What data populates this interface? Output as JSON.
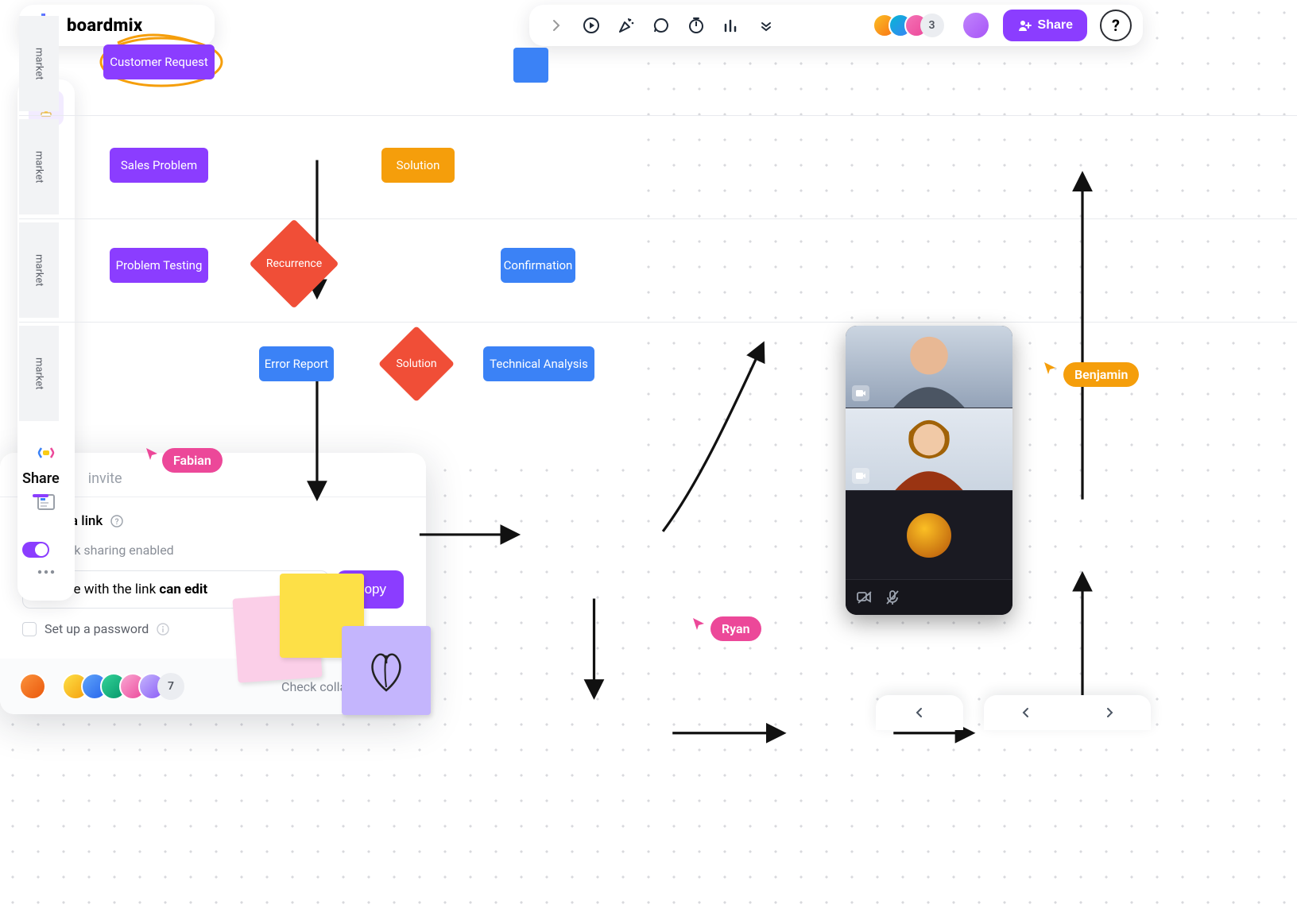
{
  "app": {
    "name": "boardmix"
  },
  "toolbar": {
    "presence_overflow": "3",
    "share_label": "Share",
    "help_label": "?"
  },
  "share_panel": {
    "tab_share": "Share",
    "tab_invite": "invite",
    "section_title": "Share via link",
    "toggle_label": "Link sharing enabled",
    "select_prefix": "Anyone with the link",
    "select_permission": "can edit",
    "copy_label": "Copy",
    "password_label": "Set up a password",
    "collab_overflow": "7",
    "check_collab": "Check collaborators"
  },
  "flow": {
    "lane_label": "market",
    "customer_request": "Customer Request",
    "sales_problem": "Sales Problem",
    "problem_testing": "Problem Testing",
    "recurrence": "Recurrence",
    "solution": "Solution",
    "error_report": "Error Report",
    "solution2": "Solution",
    "technical_analysis": "Technical Analysis",
    "confirmation": "Confirmation"
  },
  "cursors": {
    "fabian": "Fabian",
    "ryan": "Ryan",
    "benjamin": "Benjamin"
  },
  "colors": {
    "purple": "#8B3DFF",
    "blue": "#3B82F6",
    "orange": "#F59E0B",
    "redOrange": "#F04E37",
    "pink": "#EC4899"
  }
}
